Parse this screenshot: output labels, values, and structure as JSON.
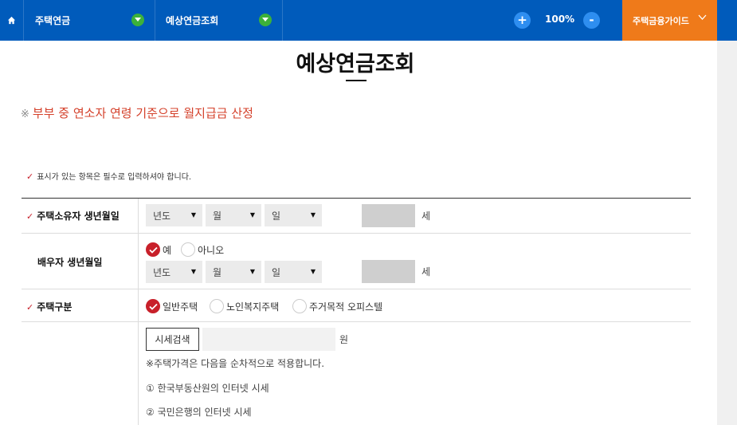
{
  "nav": {
    "home_icon": "home-icon",
    "menu1": "주택연금",
    "menu2": "예상연금조회",
    "zoom_in": "+",
    "zoom_level": "100%",
    "zoom_out": "-",
    "guide": "주택금융가이드"
  },
  "page": {
    "title": "예상연금조회",
    "notice_mark": "※",
    "notice": "부부 중 연소자 연령 기준으로 월지급금 산정",
    "required_note": "표시가 있는 항목은 필수로 입력하셔야 합니다."
  },
  "form": {
    "owner_birth": {
      "label": "주택소유자 생년월일",
      "year": "년도",
      "month": "월",
      "day": "일",
      "age_unit": "세"
    },
    "spouse_birth": {
      "label": "배우자 생년월일",
      "yes": "예",
      "no": "아니오",
      "year": "년도",
      "month": "월",
      "day": "일",
      "age_unit": "세"
    },
    "house_type": {
      "label": "주택구분",
      "opt1": "일반주택",
      "opt2": "노인복지주택",
      "opt3": "주거목적 오피스텔"
    },
    "price": {
      "search_btn": "시세검색",
      "input_value": "",
      "unit": "원",
      "info1": "※주택가격은 다음을 순차적으로 적용합니다.",
      "info2": "① 한국부동산원의 인터넷 시세",
      "info3": "② 국민은행의 인터넷 시세"
    }
  },
  "colors": {
    "nav_bg": "#005bbb",
    "guide_bg": "#ef7a1a",
    "accent_red": "#c8202a",
    "notice_red": "#d4402a"
  }
}
